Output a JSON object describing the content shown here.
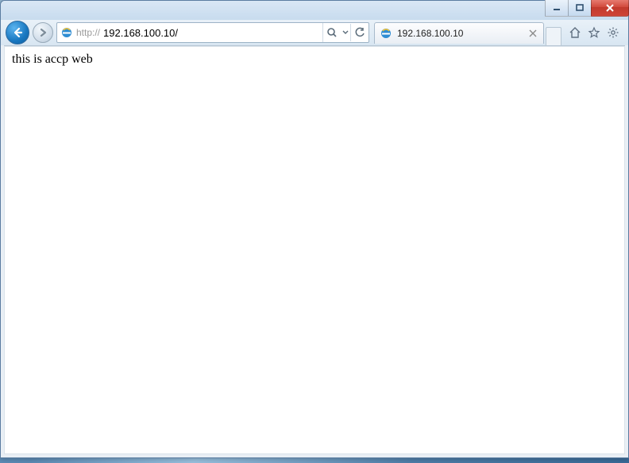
{
  "address_bar": {
    "url_prefix": "http://",
    "url_host": "192.168.100.10/",
    "full_url": "http://192.168.100.10/"
  },
  "tab": {
    "title": "192.168.100.10"
  },
  "page": {
    "body_text": "this is accp web"
  }
}
